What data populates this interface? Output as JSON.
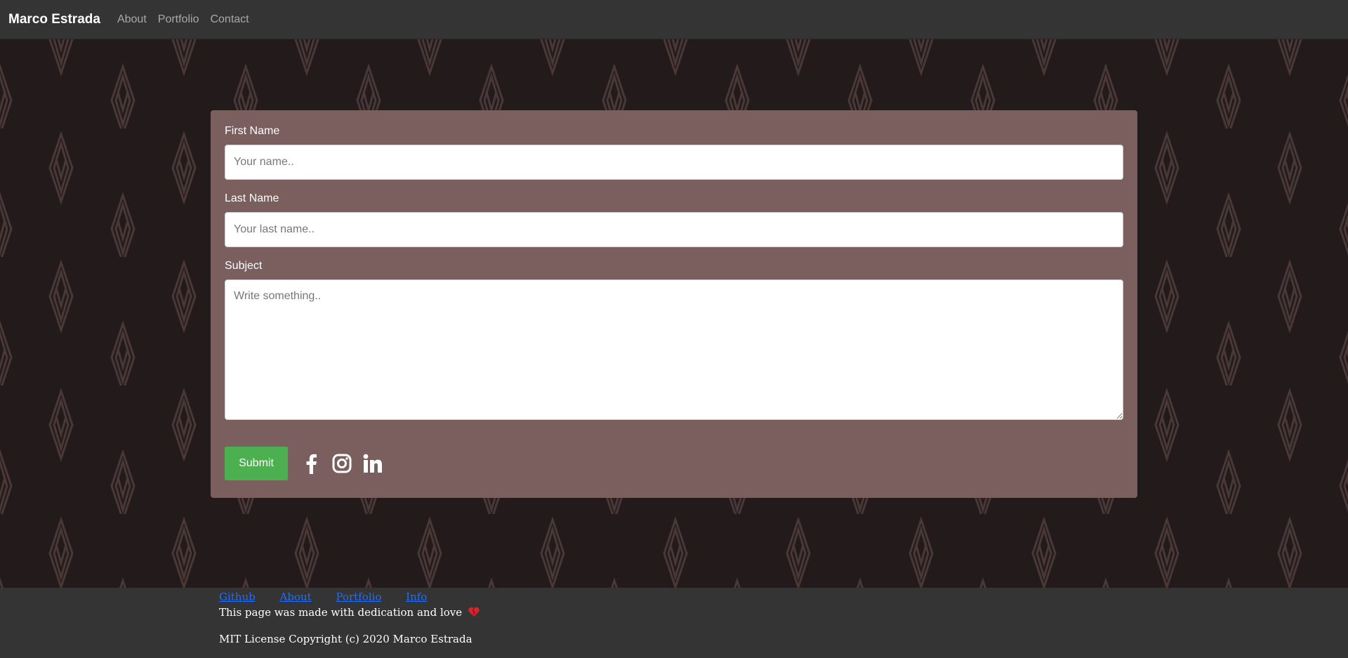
{
  "navbar": {
    "brand": "Marco Estrada",
    "links": [
      "About",
      "Portfolio",
      "Contact"
    ]
  },
  "form": {
    "first_name_label": "First Name",
    "first_name_placeholder": "Your name..",
    "last_name_label": "Last Name",
    "last_name_placeholder": "Your last name..",
    "subject_label": "Subject",
    "subject_placeholder": "Write something..",
    "submit_label": "Submit"
  },
  "social": {
    "icons": [
      "facebook-icon",
      "instagram-icon",
      "linkedin-icon"
    ]
  },
  "footer": {
    "links": [
      "Github",
      "About",
      "Portfolio",
      "Info"
    ],
    "tagline": "This page was made with dedication and love",
    "license": "MIT License Copyright (c) 2020 Marco Estrada"
  },
  "colors": {
    "background": "#231b1b",
    "pattern": "#4a3838",
    "navbar": "#343434",
    "card": "#7b5f5f",
    "submit": "#4caf50",
    "footer_link": "#1f6dff"
  }
}
